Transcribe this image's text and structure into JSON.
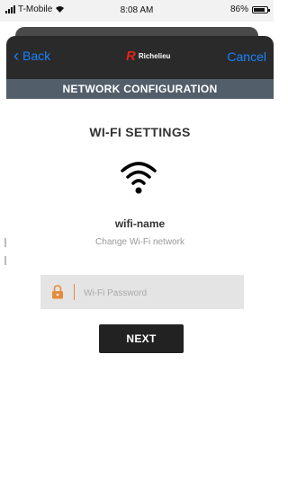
{
  "status_bar": {
    "carrier": "T-Mobile",
    "time": "8:08 AM",
    "battery": "86%",
    "battery_level": 0.86
  },
  "nav": {
    "back_label": "Back",
    "cancel_label": "Cancel",
    "logo_word": "Richelieu"
  },
  "header": {
    "title": "NETWORK CONFIGURATION"
  },
  "main": {
    "title": "WI-FI SETTINGS",
    "network_name": "wifi-name",
    "change_link": "Change Wi-Fi network",
    "password_placeholder": "Wi-Fi Password",
    "password_value": "",
    "next_label": "NEXT"
  },
  "colors": {
    "accent_blue": "#1a82ff",
    "brand_red": "#e2231a",
    "lock_orange": "#e58b3a",
    "header_bg": "#525e69"
  },
  "icons": {
    "back": "chevron-left-icon",
    "wifi": "wifi-icon",
    "lock": "lock-icon"
  }
}
